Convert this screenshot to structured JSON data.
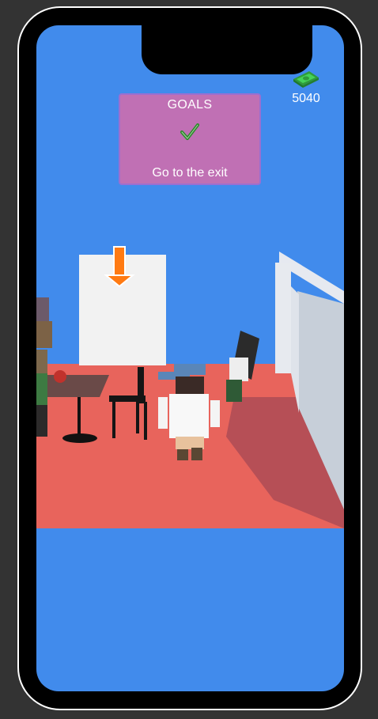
{
  "hud": {
    "money_icon": "cash-icon",
    "money_value": "5040"
  },
  "goals": {
    "title": "GOALS",
    "status_icon": "checkmark-icon",
    "objective": "Go to the exit"
  },
  "colors": {
    "sky": "#418bec",
    "floor": "#e8645c",
    "panel": "#c070b4",
    "arrow": "#ff7a12"
  }
}
